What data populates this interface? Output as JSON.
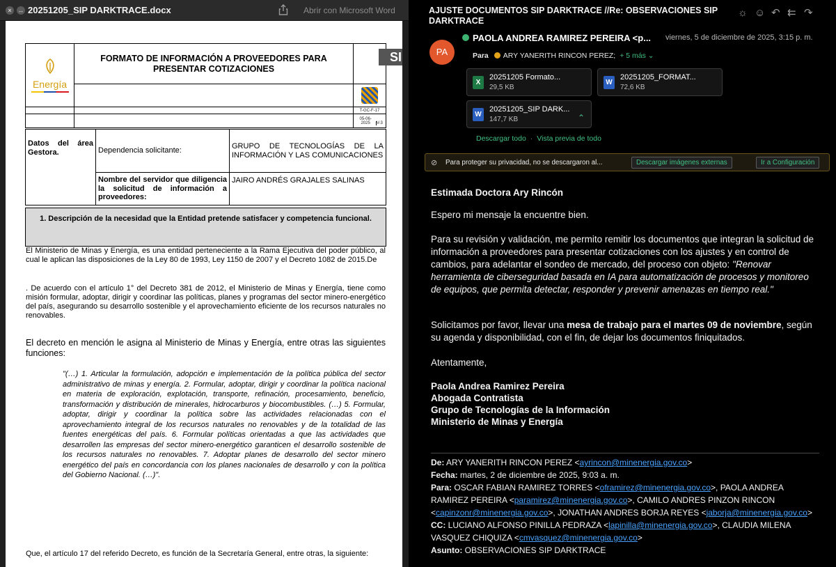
{
  "left_window": {
    "filename": "20251205_SIP DARKTRACE.docx",
    "open_with_label": "Abrir con Microsoft Word"
  },
  "document": {
    "logo_text": "Energía",
    "format_title": "FORMATO DE INFORMACIÓN A PROVEEDORES PARA PRESENTAR COTIZACIONES",
    "doc_code": "T-GC-F-17",
    "doc_date": "05-06-2025",
    "doc_version": "V-3",
    "sip_fragment": "SI",
    "area_label": "Datos del área Gestora.",
    "dependencia_label": "Dependencia solicitante:",
    "dependencia_value": "GRUPO DE TECNOLOGÍAS DE LA INFORMACIÓN Y LAS COMUNICACIONES",
    "servidor_label": "Nombre del servidor que diligencia la solicitud de información a proveedores:",
    "servidor_value": "JAIRO ANDRÉS GRAJALES SALINAS",
    "section1_title": "1. Descripción de la necesidad que la Entidad pretende satisfacer y competencia funcional.",
    "para1": "El Ministerio de Minas y Energía, es una entidad perteneciente a la Rama Ejecutiva del poder público, al cual le aplican las disposiciones de la Ley 80 de 1993, Ley 1150 de 2007 y el Decreto 1082 de 2015.De",
    "para2": ". De acuerdo con el artículo 1° del Decreto 381 de 2012, el Ministerio de Minas y Energía, tiene como misión formular, adoptar, dirigir y coordinar las políticas, planes y programas del sector minero-energético del país, asegurando su desarrollo sostenible y el aprovechamiento eficiente de los recursos naturales no renovables.",
    "para3": "El decreto en mención le asigna al Ministerio de Minas y Energía, entre otras las siguientes funciones:",
    "quote": "\"(…) 1. Articular la formulación, adopción e implementación de la política pública del sector administrativo de minas y energía. 2. Formular, adoptar, dirigir y coordinar la política nacional en materia de exploración, explotación, transporte, refinación, procesamiento, beneficio, transformación y distribución de minerales, hidrocarburos y biocombustibles. (…) 5. Formular, adoptar, dirigir y coordinar la política sobre las actividades relacionadas con el aprovechamiento integral de los recursos naturales no renovables y de la totalidad de las fuentes energéticas del país. 6. Formular políticas orientadas a que las actividades que desarrollen las empresas del sector minero-energético garanticen el desarrollo sostenible de los recursos naturales no renovables. 7. Adoptar planes de desarrollo del sector minero energético del país en concordancia con los planes nacionales de desarrollo y con la política del Gobierno Nacional. (…)\".",
    "para4": "Que, el artículo 17 del referido Decreto, es función de la Secretaría General, entre otras, la siguiente:"
  },
  "email": {
    "subject": "AJUSTE DOCUMENTOS SIP DARKTRACE //Re: OBSERVACIONES SIP DARKTRACE",
    "avatar_initials": "PA",
    "sender": "PAOLA ANDREA RAMIREZ PEREIRA <p...",
    "date": "viernes, 5 de diciembre de 2025, 3:15 p. m.",
    "to_label": "Para",
    "to_name": "ARY YANERITH RINCON PEREZ;",
    "more_recipients": "+ 5 más ⌄",
    "attachments": [
      {
        "name": "20251205 Formato...",
        "size": "29,5 KB",
        "type": "excel"
      },
      {
        "name": "20251205_FORMAT...",
        "size": "72,6 KB",
        "type": "word"
      },
      {
        "name": "20251205_SIP DARK...",
        "size": "147,7 KB",
        "type": "word"
      }
    ],
    "download_all": "Descargar todo",
    "preview_all": "Vista previa de todo",
    "privacy_text": "Para proteger su privacidad, no se descargaron al...",
    "download_images_button": "Descargar imágenes externas",
    "settings_button": "Ir a Configuración",
    "greeting": "Estimada Doctora Ary Rincón",
    "line1": "Espero mi mensaje la encuentre bien.",
    "para1": "Para su revisión y validación, me permito remitir los documentos que integran la solicitud de información a proveedores para presentar cotizaciones con los ajustes y en control de cambios, para adelantar el sondeo de mercado, del proceso con objeto: ",
    "para1_quote": "\"Renovar herramienta de ciberseguridad basada en IA para automatización de procesos y monitoreo de equipos, que permita detectar, responder y prevenir amenazas en tiempo real.\"",
    "para2_a": "Solicitamos por favor, llevar una ",
    "para2_bold": "mesa de trabajo para el martes 09 de noviembre",
    "para2_b": ", según su agenda y disponibilidad, con el fin, de dejar los documentos finiquitados.",
    "closing": "Atentamente,",
    "signature": [
      "Paola Andrea Ramirez Pereira",
      "Abogada Contratista",
      "Grupo de Tecnologías de la Información",
      "Ministerio de Minas y Energía"
    ],
    "quoted": {
      "from_label": "De:",
      "from_name": "ARY YANERITH RINCON PEREZ <",
      "from_email": "ayrincon@minenergia.gov.co",
      "date_label": "Fecha:",
      "date_value": "martes, 2 de diciembre de 2025, 9:03 a. m.",
      "to_label": "Para:",
      "to_1": "OSCAR FABIAN RAMIREZ TORRES <",
      "to_1_email": "oframirez@minenergia.gov.co",
      "to_2": ">, PAOLA ANDREA RAMIREZ PEREIRA <",
      "to_2_email": "paramirez@minenergia.gov.co",
      "to_3": ">, CAMILO ANDRES PINZON RINCON <",
      "to_3_email": "capinzonr@minenergia.gov.co",
      "to_4": ">, JONATHAN ANDRES BORJA REYES <",
      "to_4_email": "jaborja@minenergia.gov.co",
      "cc_label": "CC:",
      "cc_1": "LUCIANO ALFONSO PINILLA PEDRAZA <",
      "cc_1_email": "lapinilla@minenergia.gov.co",
      "cc_2": ">, CLAUDIA MILENA VASQUEZ CHIQUIZA <",
      "cc_2_email": "cmvasquez@minenergia.gov.co",
      "subject_label": "Asunto:",
      "subject_value": "OBSERVACIONES SIP DARKTRACE"
    }
  },
  "colors": {
    "avatar": "#e2572c",
    "accent_green": "#41c285",
    "link_blue": "#4aa3ff",
    "banner_border": "#6a5518"
  }
}
